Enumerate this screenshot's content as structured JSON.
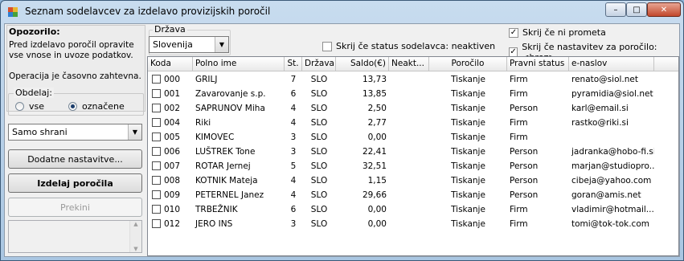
{
  "window": {
    "title": "Seznam sodelavcev za izdelavo provizijskih poročil",
    "controls": {
      "minimize": "–",
      "maximize": "□",
      "close": "✕"
    }
  },
  "left": {
    "warning_title": "Opozorilo:",
    "warning_text": "Pred izdelavo poročil opravite vse vnose in uvoze podatkov.",
    "warning_text2": "Operacija je časovno zahtevna.",
    "scope_group": "Obdelaj:",
    "scope_all": "vse",
    "scope_selected": "označene",
    "scope_value": "označene",
    "mode_select": "Samo shrani",
    "more_settings_button": "Dodatne nastavitve...",
    "make_reports_button": "Izdelaj poročila",
    "cancel_button": "Prekini",
    "log_scroll_up": "▲",
    "log_scroll_down": "▼"
  },
  "filters": {
    "country_group": "Država",
    "country_value": "Slovenija",
    "hide_inactive_label": "Skrij če status sodelavca: neaktiven",
    "hide_inactive_checked": false,
    "hide_no_traffic_label": "Skrij če ni prometa",
    "hide_no_traffic_checked": true,
    "hide_no_settings_label": "Skrij če nastavitev za poročilo: <brez>",
    "hide_no_settings_checked": true
  },
  "grid": {
    "columns": [
      "Koda",
      "Polno ime",
      "St.",
      "Država",
      "Saldo(€)",
      "Neakt...",
      "Poročilo",
      "Pravni status",
      "e-naslov"
    ],
    "rows": [
      {
        "code": "000",
        "name": "GRILJ",
        "st": "7",
        "country": "SLO",
        "balance": "13,73",
        "inactive": "",
        "report": "Tiskanje",
        "legal": "Firm",
        "email": "renato@siol.net"
      },
      {
        "code": "001",
        "name": "Zavarovanje s.p.",
        "st": "6",
        "country": "SLO",
        "balance": "13,85",
        "inactive": "",
        "report": "Tiskanje",
        "legal": "Firm",
        "email": "pyramidia@siol.net"
      },
      {
        "code": "002",
        "name": "SAPRUNOV Miha",
        "st": "4",
        "country": "SLO",
        "balance": "2,50",
        "inactive": "",
        "report": "Tiskanje",
        "legal": "Person",
        "email": "karl@email.si"
      },
      {
        "code": "004",
        "name": "Riki",
        "st": "4",
        "country": "SLO",
        "balance": "2,77",
        "inactive": "",
        "report": "Tiskanje",
        "legal": "Firm",
        "email": "rastko@riki.si"
      },
      {
        "code": "005",
        "name": "KIMOVEC",
        "st": "3",
        "country": "SLO",
        "balance": "0,00",
        "inactive": "",
        "report": "Tiskanje",
        "legal": "Firm",
        "email": ""
      },
      {
        "code": "006",
        "name": "LUŠTREK Tone",
        "st": "3",
        "country": "SLO",
        "balance": "22,41",
        "inactive": "",
        "report": "Tiskanje",
        "legal": "Person",
        "email": "jadranka@hobo-fi.si"
      },
      {
        "code": "007",
        "name": "ROTAR Jernej",
        "st": "5",
        "country": "SLO",
        "balance": "32,51",
        "inactive": "",
        "report": "Tiskanje",
        "legal": "Person",
        "email": "marjan@studiopro..."
      },
      {
        "code": "008",
        "name": "KOTNIK Mateja",
        "st": "4",
        "country": "SLO",
        "balance": "1,15",
        "inactive": "",
        "report": "Tiskanje",
        "legal": "Person",
        "email": "cibeja@yahoo.com"
      },
      {
        "code": "009",
        "name": "PETERNEL Janez",
        "st": "4",
        "country": "SLO",
        "balance": "29,66",
        "inactive": "",
        "report": "Tiskanje",
        "legal": "Person",
        "email": "goran@amis.net"
      },
      {
        "code": "010",
        "name": "TRBEŽNIK",
        "st": "6",
        "country": "SLO",
        "balance": "0,00",
        "inactive": "",
        "report": "Tiskanje",
        "legal": "Firm",
        "email": "vladimir@hotmail...."
      },
      {
        "code": "012",
        "name": "JERO INS",
        "st": "3",
        "country": "SLO",
        "balance": "0,00",
        "inactive": "",
        "report": "Tiskanje",
        "legal": "Firm",
        "email": "tomi@tok-tok.com"
      }
    ]
  }
}
